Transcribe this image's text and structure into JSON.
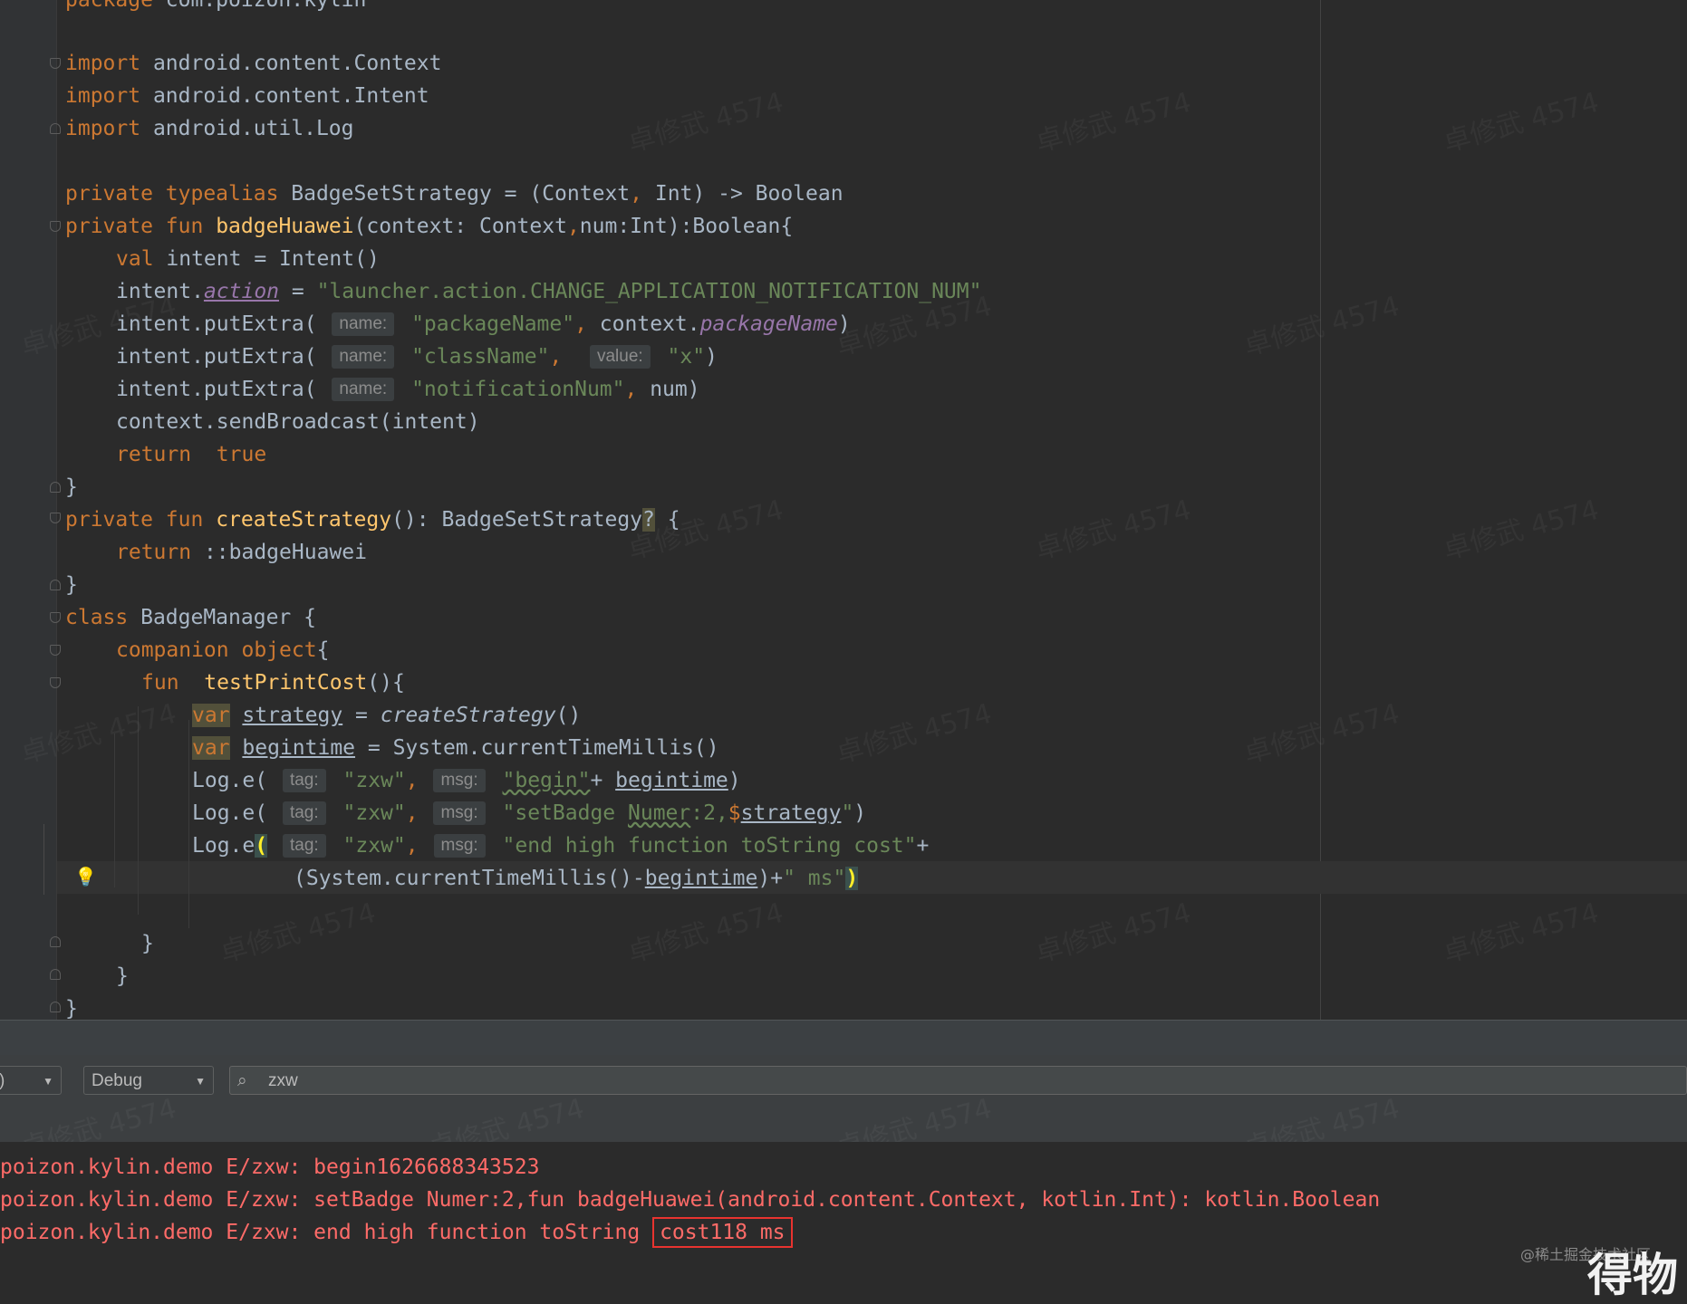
{
  "editor": {
    "lines": [
      {
        "t": "package com.poizon.kylin"
      },
      {
        "t": "import android.content.Context"
      },
      {
        "t": "import android.content.Intent"
      },
      {
        "t": "import android.util.Log"
      },
      {
        "t": "private typealias BadgeSetStrategy = (Context, Int) -> Boolean"
      },
      {
        "t": "private fun badgeHuawei(context: Context,num:Int):Boolean{"
      },
      {
        "t": "val intent = Intent()"
      },
      {
        "t": "intent.action = \"launcher.action.CHANGE_APPLICATION_NOTIFICATION_NUM\""
      },
      {
        "t": "intent.putExtra( name: \"packageName\", context.packageName)"
      },
      {
        "t": "intent.putExtra( name: \"className\",  value: \"x\")"
      },
      {
        "t": "intent.putExtra( name: \"notificationNum\", num)"
      },
      {
        "t": "context.sendBroadcast(intent)"
      },
      {
        "t": "return  true"
      },
      {
        "t": "}"
      },
      {
        "t": "private fun createStrategy(): BadgeSetStrategy? {"
      },
      {
        "t": "return ::badgeHuawei"
      },
      {
        "t": "}"
      },
      {
        "t": "class BadgeManager {"
      },
      {
        "t": "companion object{"
      },
      {
        "t": "fun  testPrintCost(){"
      },
      {
        "t": "var strategy = createStrategy()"
      },
      {
        "t": "var begintime = System.currentTimeMillis()"
      },
      {
        "t": "Log.e( tag: \"zxw\", msg: \"begin\"+ begintime)"
      },
      {
        "t": "Log.e( tag: \"zxw\", msg: \"setBadge Numer:2,$strategy\")"
      },
      {
        "t": "Log.e( tag: \"zxw\", msg: \"end high function toString cost\"+"
      },
      {
        "t": "(System.currentTimeMillis()-begintime)+\" ms\")"
      },
      {
        "t": "}"
      },
      {
        "t": "}"
      },
      {
        "t": "}"
      }
    ],
    "hints": {
      "name": "name:",
      "value": "value:",
      "tag": "tag:",
      "msg": "msg:"
    },
    "watermark": "卓修武 4574"
  },
  "logcat": {
    "process_dropdown": ")",
    "level_dropdown": "Debug",
    "search_value": "zxw",
    "lines": [
      "poizon.kylin.demo E/zxw: begin1626688343523",
      "poizon.kylin.demo E/zxw: setBadge Numer:2,fun badgeHuawei(android.content.Context, kotlin.Int): kotlin.Boolean",
      "poizon.kylin.demo E/zxw: end high function toString "
    ],
    "highlighted": "cost118 ms"
  },
  "footer": {
    "credit": "@稀土掘金技术社区",
    "logo": "得物"
  },
  "colors": {
    "keyword": "#cc7832",
    "function": "#ffc66d",
    "string": "#6a8759",
    "property": "#9876aa",
    "default": "#a9b7c6",
    "log_error": "#ff6b68",
    "highlight_box": "#e8332f"
  }
}
